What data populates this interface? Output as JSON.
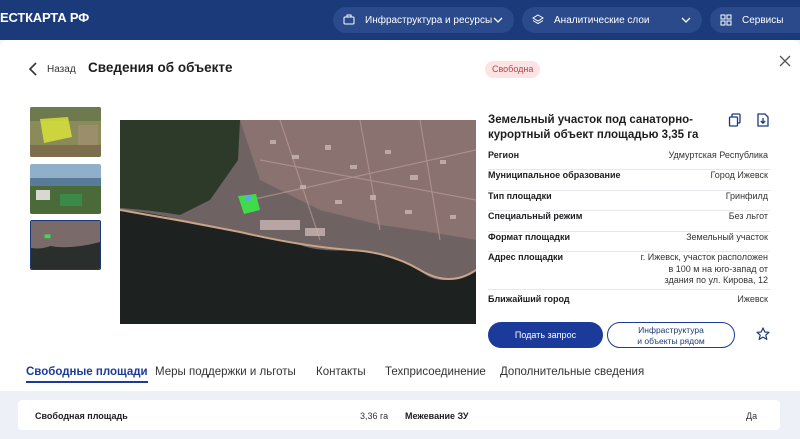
{
  "header": {
    "logo": "ЕСТКАРТА РФ",
    "nav": [
      {
        "label": "Инфраструктура и ресурсы"
      },
      {
        "label": "Аналитические слои"
      },
      {
        "label": "Сервисы"
      }
    ]
  },
  "modal": {
    "back_label": "Назад",
    "title": "Сведения об объекте",
    "status_badge": "Свободна",
    "object": {
      "title": "Земельный участок под санаторно-курортный объект площадью 3,35 га",
      "properties": [
        {
          "key": "Регион",
          "value": "Удмуртская Республика"
        },
        {
          "key": "Муниципальное образование",
          "value": "Город Ижевск"
        },
        {
          "key": "Тип площадки",
          "value": "Гринфилд"
        },
        {
          "key": "Специальный режим",
          "value": "Без льгот"
        },
        {
          "key": "Формат площадки",
          "value": "Земельный участок"
        },
        {
          "key": "Адрес площадки",
          "value_lines": [
            "г. Ижевск, участок расположен",
            "в 100 м на юго-запад от",
            "здания по ул. Кирова, 12"
          ]
        },
        {
          "key": "Ближайший город",
          "value": "Ижевск"
        }
      ]
    },
    "actions": {
      "request_label": "Подать запрос",
      "infra_label_line1": "Инфраструктура",
      "infra_label_line2": "и объекты рядом"
    },
    "tabs": [
      {
        "label": "Свободные площади",
        "active": true
      },
      {
        "label": "Меры поддержки и льготы",
        "active": false
      },
      {
        "label": "Контакты",
        "active": false
      },
      {
        "label": "Техприсоединение",
        "active": false
      },
      {
        "label": "Дополнительные сведения",
        "active": false
      }
    ],
    "details": [
      {
        "key": "Свободная площадь",
        "value": "3,36 га"
      },
      {
        "key": "Межевание ЗУ",
        "value": "Да"
      }
    ]
  },
  "colors": {
    "header_bg": "#1b3a7a",
    "accent": "#1b3a9a",
    "badge_bg": "#fde3e3",
    "badge_text": "#b34747",
    "plot_highlight": "#3fdc4a"
  },
  "icons": [
    "building-icon",
    "layers-icon",
    "grid-icon",
    "chevron-down-icon",
    "chevron-left-icon",
    "close-icon",
    "copy-icon",
    "download-icon",
    "star-icon"
  ]
}
